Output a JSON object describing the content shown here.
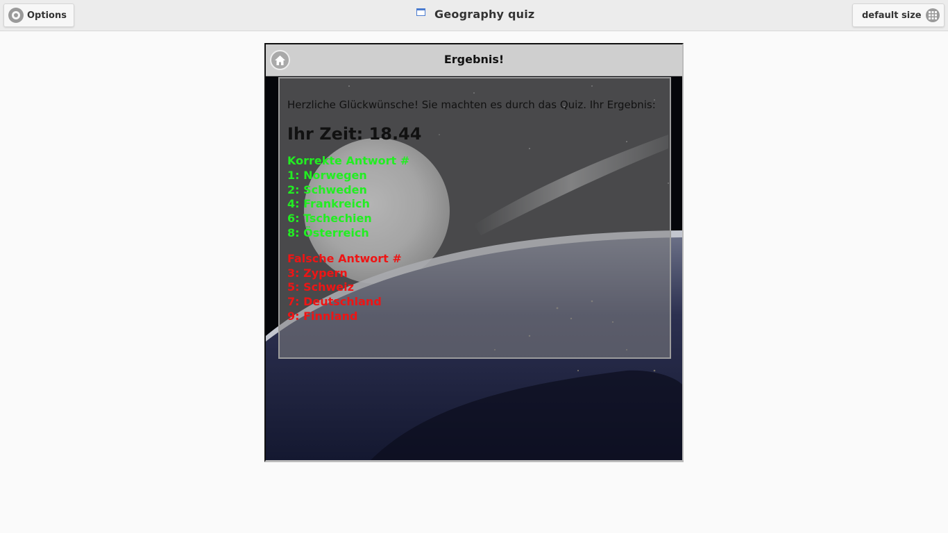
{
  "topbar": {
    "options_label": "Options",
    "window_title": "Geography quiz",
    "size_label": "default size"
  },
  "app": {
    "header_title": "Ergebnis!",
    "intro": "Herzliche Glückwünsche! Sie machten es durch das Quiz. Ihr Ergebnis:",
    "time_text": "Ihr Zeit: 18.44",
    "correct": {
      "heading": "Korrekte Antwort #",
      "items": [
        "1: Norwegen",
        "2: Schweden",
        "4: Frankreich",
        "6: Tschechien",
        "8: Österreich"
      ]
    },
    "wrong": {
      "heading": "Falsche Antwort #",
      "items": [
        "3: Zypern",
        "5: Schweiz",
        "7: Deutschland",
        "9: Finnland"
      ]
    }
  },
  "colors": {
    "correct": "#22ee22",
    "wrong": "#ee1515",
    "header_bg": "#cfcfcf",
    "topbar_bg": "#ececec"
  },
  "icons": {
    "options": "gear-icon",
    "size": "grid-icon",
    "window": "window-icon",
    "home": "home-icon"
  }
}
